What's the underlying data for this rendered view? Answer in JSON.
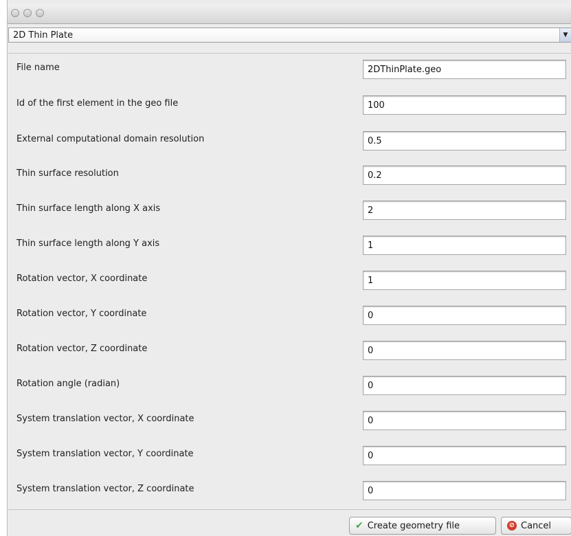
{
  "window": {
    "template_select": {
      "value": "2D Thin Plate"
    }
  },
  "form": {
    "fields": [
      {
        "label": "File name",
        "value": "2DThinPlate.geo"
      },
      {
        "label": "Id of the first element in the geo file",
        "value": "100"
      },
      {
        "label": "External computational domain resolution",
        "value": "0.5"
      },
      {
        "label": "Thin surface resolution",
        "value": "0.2"
      },
      {
        "label": "Thin surface length along X axis",
        "value": "2"
      },
      {
        "label": "Thin surface length along Y axis",
        "value": "1"
      },
      {
        "label": "Rotation vector, X coordinate",
        "value": "1"
      },
      {
        "label": "Rotation vector, Y coordinate",
        "value": "0"
      },
      {
        "label": "Rotation vector, Z coordinate",
        "value": "0"
      },
      {
        "label": "Rotation angle (radian)",
        "value": "0"
      },
      {
        "label": "System translation vector, X coordinate",
        "value": "0"
      },
      {
        "label": "System translation vector, Y coordinate",
        "value": "0"
      },
      {
        "label": "System translation vector, Z coordinate",
        "value": "0"
      }
    ]
  },
  "buttons": {
    "create_label": "Create geometry file",
    "cancel_label": "Cancel"
  },
  "icons": {
    "create": "checkmark-icon",
    "cancel": "cancel-icon"
  }
}
